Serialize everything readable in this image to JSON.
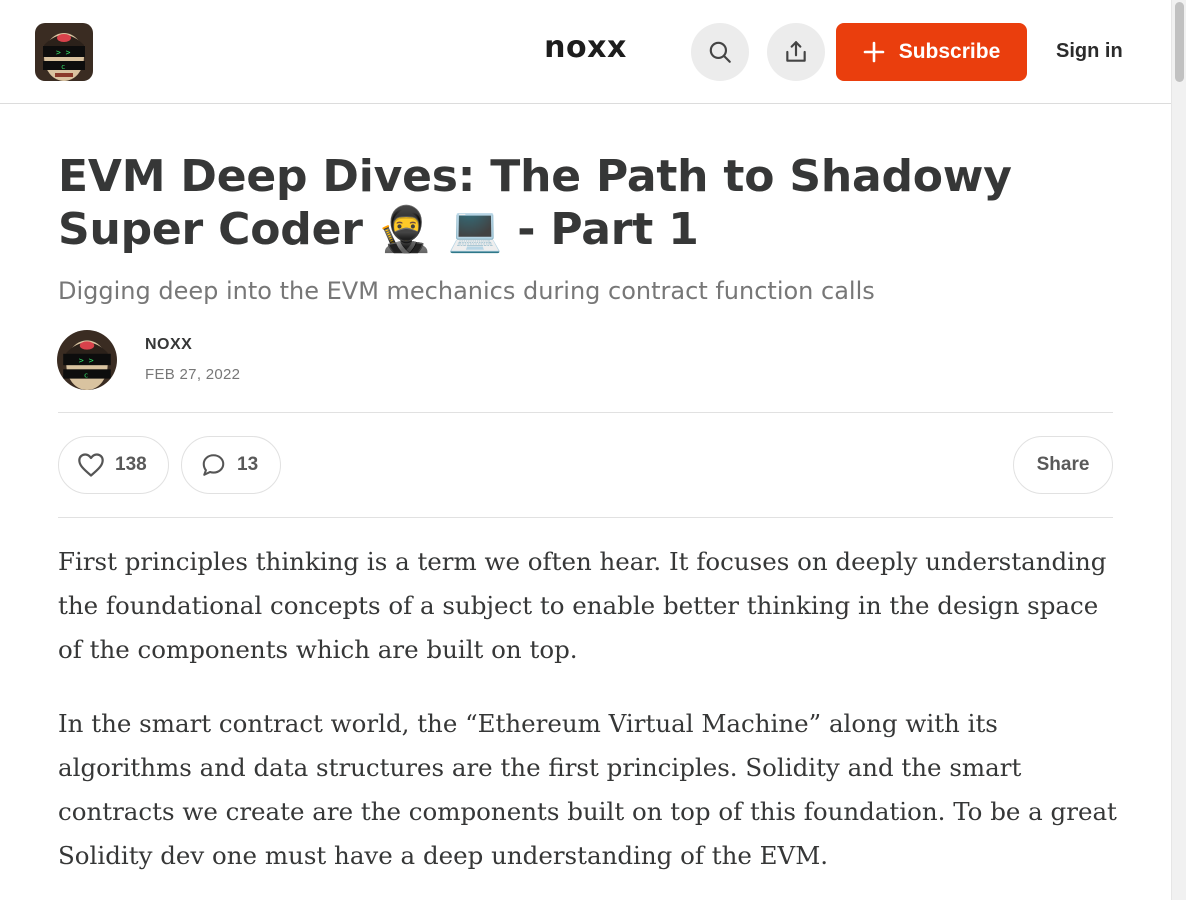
{
  "header": {
    "publication_name": "noxx",
    "search_icon": "search-icon",
    "share_icon": "share-upload-icon",
    "subscribe_label": "Subscribe",
    "subscribe_icon": "plus-icon",
    "signin_label": "Sign in"
  },
  "article": {
    "title": "EVM Deep Dives: The Path to Shadowy Super Coder 🥷 💻 - Part 1",
    "subtitle": "Digging deep into the EVM mechanics during contract function calls",
    "author": "NOXX",
    "date": "FEB 27, 2022"
  },
  "actions": {
    "likes": "138",
    "comments": "13",
    "share_label": "Share"
  },
  "body": {
    "paragraphs": [
      "First principles thinking is a term we often hear. It focuses on deeply understanding the foundational concepts of a subject to enable better thinking in the design space of the components which are built on top.",
      "In the smart contract world, the “Ethereum Virtual Machine” along with its algorithms and data structures are the first principles. Solidity and the smart contracts we create are the components built on top of this foundation. To be a great Solidity dev one must have a deep understanding of the EVM."
    ]
  },
  "colors": {
    "accent": "#ea3e0d",
    "text": "#363737",
    "muted": "#777777",
    "border": "#e1e1e1"
  }
}
